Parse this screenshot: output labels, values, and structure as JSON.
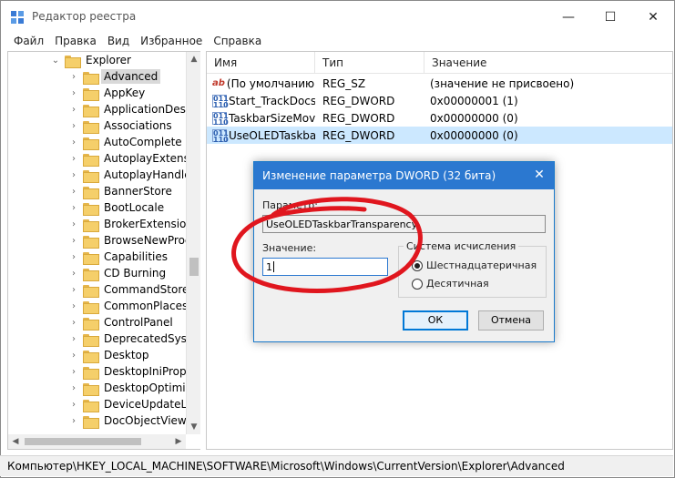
{
  "window": {
    "title": "Редактор реестра",
    "controls": {
      "minimize": "—",
      "maximize": "☐",
      "close": "✕"
    }
  },
  "menu": [
    "Файл",
    "Правка",
    "Вид",
    "Избранное",
    "Справка"
  ],
  "tree": {
    "parent": "Explorer",
    "selected": "Advanced",
    "items": [
      "Advanced",
      "AppKey",
      "ApplicationDestin",
      "Associations",
      "AutoComplete",
      "AutoplayExtensio",
      "AutoplayHandlers",
      "BannerStore",
      "BootLocale",
      "BrokerExtensions",
      "BrowseNewProce",
      "Capabilities",
      "CD Burning",
      "CommandStore",
      "CommonPlaces",
      "ControlPanel",
      "DeprecatedSystem",
      "Desktop",
      "DesktopIniProper",
      "DesktopOptimiza",
      "DeviceUpdateLoc",
      "DocObjectView"
    ]
  },
  "list": {
    "columns": [
      "Имя",
      "Тип",
      "Значение"
    ],
    "rows": [
      {
        "icon": "string-value-icon",
        "name": "(По умолчанию)",
        "type": "REG_SZ",
        "data": "(значение не присвоено)"
      },
      {
        "icon": "dword-value-icon",
        "name": "Start_TrackDocs",
        "type": "REG_DWORD",
        "data": "0x00000001 (1)"
      },
      {
        "icon": "dword-value-icon",
        "name": "TaskbarSizeMove",
        "type": "REG_DWORD",
        "data": "0x00000000 (0)"
      },
      {
        "icon": "dword-value-icon",
        "name": "UseOLEDTaskbar...",
        "type": "REG_DWORD",
        "data": "0x00000000 (0)"
      }
    ]
  },
  "statusbar": "Компьютер\\HKEY_LOCAL_MACHINE\\SOFTWARE\\Microsoft\\Windows\\CurrentVersion\\Explorer\\Advanced",
  "dialog": {
    "title": "Изменение параметра DWORD (32 бита)",
    "param_label": "Параметр:",
    "param_value": "UseOLEDTaskbarTransparency",
    "value_label": "Значение:",
    "value": "1",
    "base_group": "Система исчисления",
    "base_hex": "Шестнадцатеричная",
    "base_dec": "Десятичная",
    "base_selected": "hex",
    "ok": "ОК",
    "cancel": "Отмена"
  },
  "colors": {
    "accent": "#2b78d0",
    "selection": "#cce8ff",
    "annotation": "#e0161e"
  }
}
